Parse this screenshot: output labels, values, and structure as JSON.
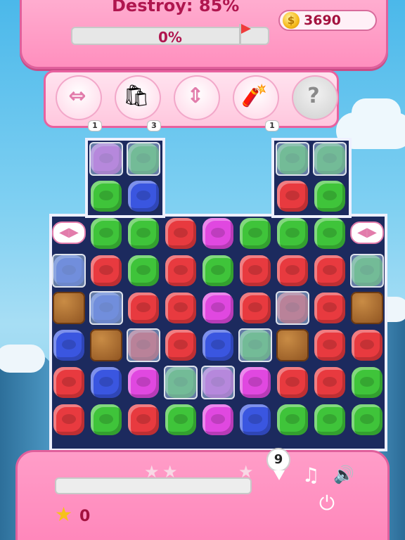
{
  "hud": {
    "goal_text": "Destroy: 85%",
    "goal_progress_text": "0%",
    "goal_progress": 0,
    "coins": "3690",
    "coin_symbol": "$"
  },
  "boosters": [
    {
      "name": "horizontal-arrows",
      "glyph": "⇔",
      "count": "1"
    },
    {
      "name": "color-bag",
      "glyph": "🛍",
      "count": "3"
    },
    {
      "name": "vertical-arrows",
      "glyph": "⇕",
      "count": ""
    },
    {
      "name": "dynamite",
      "glyph": "🧨",
      "count": "1"
    },
    {
      "name": "locked",
      "glyph": "?",
      "count": ""
    }
  ],
  "board": {
    "grid": [
      [
        "_",
        "PI",
        "GI",
        "_",
        "_",
        "_",
        "GI",
        "GI",
        "_"
      ],
      [
        "_",
        "G",
        "B",
        "_",
        "_",
        "_",
        "R",
        "G",
        "_"
      ],
      [
        "AL",
        "G",
        "G",
        "R",
        "P",
        "G",
        "G",
        "G",
        "AR"
      ],
      [
        "BI",
        "R",
        "G",
        "R",
        "G",
        "R",
        "R",
        "R",
        "GI"
      ],
      [
        "K",
        "BI",
        "R",
        "R",
        "P",
        "R",
        "RI",
        "R",
        "K"
      ],
      [
        "B",
        "K",
        "RI",
        "R",
        "B",
        "GI",
        "K",
        "R",
        "R"
      ],
      [
        "R",
        "B",
        "P",
        "GI",
        "PI",
        "P",
        "R",
        "R",
        "G"
      ],
      [
        "R",
        "G",
        "R",
        "G",
        "P",
        "B",
        "G",
        "G",
        "G"
      ]
    ],
    "colors": {
      "R": "#e83a3f",
      "G": "#3fc43a",
      "B": "#3a56e0",
      "P": "#e048e0"
    }
  },
  "footer": {
    "moves_left": "9",
    "score_progress": 0,
    "stars_earned": "0",
    "music_icon": "♫",
    "sound_icon": "🔊",
    "power_icon": "⏻"
  }
}
